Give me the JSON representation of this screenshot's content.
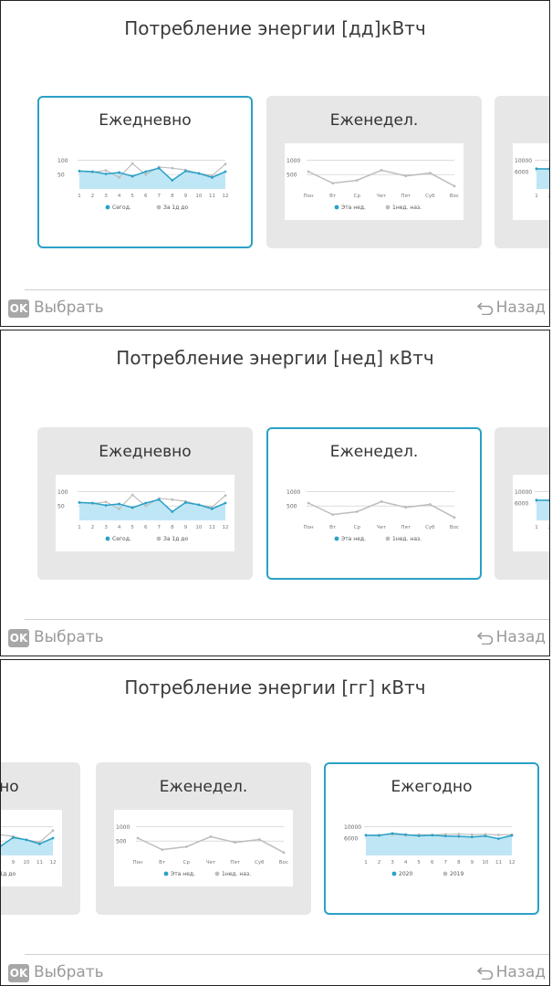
{
  "common": {
    "ok_badge": "OK",
    "select_label": "Выбрать",
    "back_label": "Назад"
  },
  "cards": {
    "daily": "Ежедневно",
    "weekly": "Еженедел.",
    "yearly": "Ежегодно"
  },
  "panels": [
    {
      "title": "Потребление энергии [дд]кВтч",
      "selected": "daily"
    },
    {
      "title": "Потребление энергии [нед] кВтч",
      "selected": "weekly"
    },
    {
      "title": "Потребление энергии [гг] кВтч",
      "selected": "yearly"
    }
  ],
  "charts": {
    "daily": {
      "y_ticks": [
        "100",
        "50"
      ],
      "x_ticks": [
        "1",
        "2",
        "3",
        "4",
        "5",
        "6",
        "7",
        "8",
        "9",
        "10",
        "11",
        "12"
      ],
      "legend": [
        "Сегод.",
        "За 1д до"
      ],
      "series_current": [
        62,
        60,
        52,
        57,
        44,
        60,
        72,
        30,
        62,
        54,
        40,
        60
      ],
      "series_previous": [
        62,
        58,
        64,
        40,
        88,
        50,
        76,
        72,
        66,
        54,
        46,
        86
      ],
      "ylim": [
        0,
        120
      ]
    },
    "weekly": {
      "y_ticks": [
        "1000",
        "500"
      ],
      "x_ticks": [
        "Пон",
        "Вт",
        "Ср",
        "Чет",
        "Пят",
        "Суб",
        "Вос"
      ],
      "legend": [
        "Эта нед.",
        "1нед. наз."
      ],
      "series_current": [
        600,
        200,
        300,
        650,
        450,
        550,
        100
      ],
      "ylim": [
        0,
        1200
      ]
    },
    "yearly": {
      "y_ticks": [
        "10000",
        "6000"
      ],
      "x_ticks": [
        "1",
        "2",
        "3",
        "4",
        "5",
        "6",
        "7",
        "8",
        "9",
        "10",
        "11",
        "12"
      ],
      "legend": [
        "2020",
        "2019"
      ],
      "series_current": [
        7000,
        6900,
        7600,
        7200,
        6800,
        7000,
        6700,
        6600,
        6400,
        6700,
        5800,
        6900
      ],
      "series_previous": [
        6900,
        7100,
        7300,
        7000,
        7200,
        7100,
        7300,
        7400,
        7200,
        7300,
        7100,
        7200
      ],
      "ylim": [
        0,
        12000
      ]
    },
    "colors": {
      "accent": "#2aa1c7",
      "fill": "#bfe6f5",
      "previous": "#bdbdbd",
      "grid": "#c8c8c8"
    }
  }
}
